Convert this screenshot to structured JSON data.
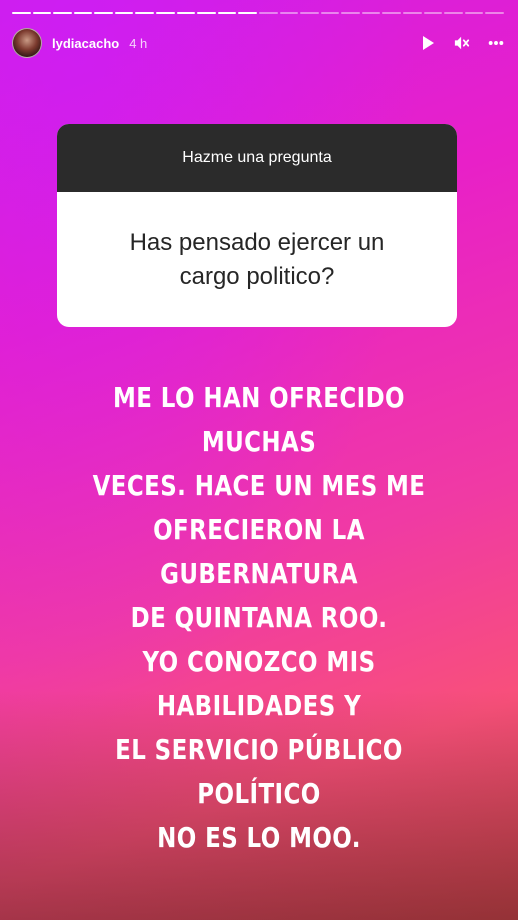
{
  "header": {
    "username": "lydiacacho",
    "timestamp": "4 h",
    "icons": [
      "play-icon",
      "mute-icon",
      "more-icon"
    ]
  },
  "progress": {
    "segments_total": 24,
    "segments_seen": 12
  },
  "question_sticker": {
    "title": "Hazme una pregunta",
    "question": "Has pensado ejercer un cargo politico?"
  },
  "answer": {
    "line1": "ME LO HAN OFRECIDO MUCHAS",
    "line2": "VECES. HACE UN MES ME",
    "line3": "OFRECIERON LA GUBERNATURA",
    "line4": "DE QUINTANA ROO.",
    "line5": "YO CONOZCO MIS HABILIDADES Y",
    "line6": "EL SERVICIO PÚBLICO POLÍTICO",
    "line7": "NO ES LO MOO."
  },
  "colors": {
    "gradient_top": "#d21ee6",
    "gradient_bottom": "#f8507a",
    "card_header_bg": "#2b2b2b"
  }
}
